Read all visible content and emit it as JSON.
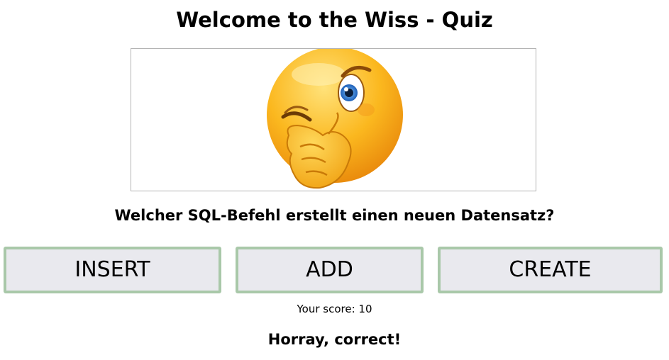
{
  "quiz": {
    "title": "Welcome to the Wiss - Quiz",
    "image_icon": "thinking-winking-emoji",
    "question": "Welcher SQL-Befehl erstellt einen neuen Datensatz?",
    "answers": [
      {
        "label": "INSERT"
      },
      {
        "label": "ADD"
      },
      {
        "label": "CREATE"
      }
    ],
    "score_text": "Your score: 10",
    "feedback": "Horray, correct!"
  },
  "colors": {
    "button_background": "#e9e9ee",
    "button_border": "#a9c8a9",
    "image_border": "#b3b3b3"
  }
}
